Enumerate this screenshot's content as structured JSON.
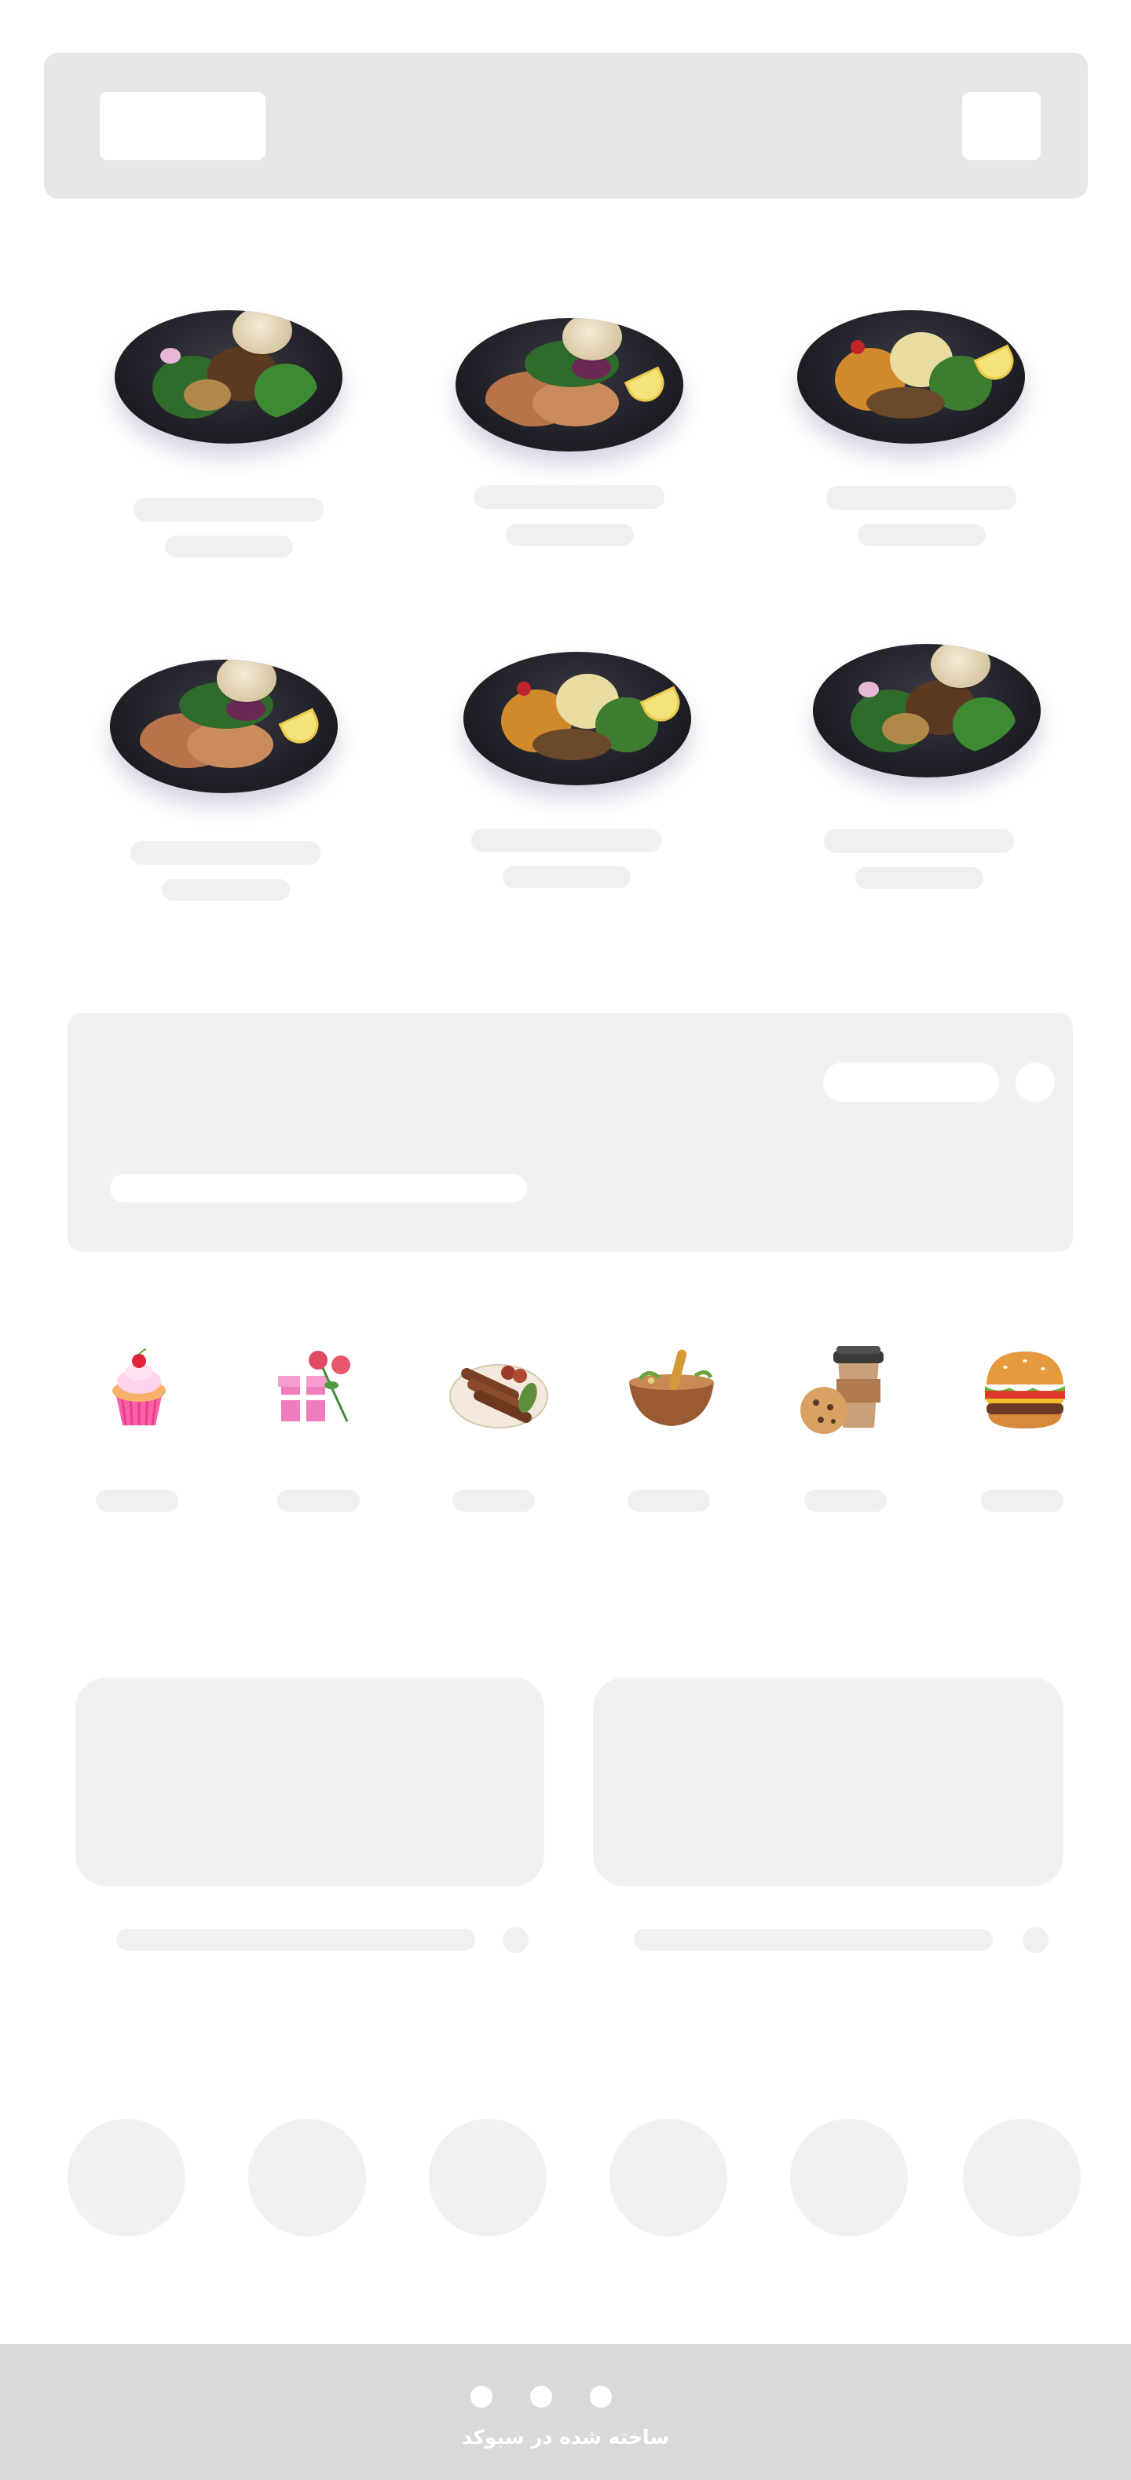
{
  "header": {
    "logo_icon": "logo-placeholder",
    "menu_icon": "menu-placeholder"
  },
  "products": [
    {
      "image": "salad-bowl-walnut-broccoli"
    },
    {
      "image": "grilled-chicken-salad-plate"
    },
    {
      "image": "mixed-vegetable-salad-plate"
    },
    {
      "image": "grilled-chicken-salad-plate"
    },
    {
      "image": "mixed-vegetable-salad-plate"
    },
    {
      "image": "salad-bowl-walnut-broccoli"
    }
  ],
  "categories": [
    {
      "icon": "cupcake-icon"
    },
    {
      "icon": "gift-with-roses-icon"
    },
    {
      "icon": "kebab-plate-icon"
    },
    {
      "icon": "mortar-pestle-herbs-icon"
    },
    {
      "icon": "coffee-cup-cookie-icon"
    },
    {
      "icon": "burger-icon"
    }
  ],
  "footer": {
    "credit": "ساخته شده در سبوکد",
    "dots": 3
  },
  "colors": {
    "skeleton": "#f0f0f0",
    "header_bg": "#e6e6e6",
    "footer_bg": "#d9d9d9",
    "plate": "#22222a"
  }
}
